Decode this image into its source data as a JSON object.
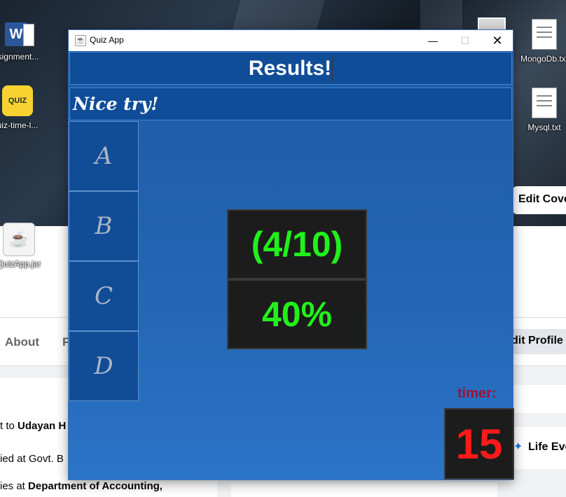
{
  "background": {
    "desktop_icons": [
      {
        "label": "ssignment...",
        "icon": "word-doc-icon"
      },
      {
        "label": "uiz-time-l...",
        "icon": "quiz-image-icon"
      },
      {
        "label": "QuizApp.jar",
        "icon": "java-jar-icon"
      },
      {
        "label": "MongoDb.txt",
        "icon": "text-file-icon"
      },
      {
        "label": "Mysql.txt",
        "icon": "text-file-icon"
      }
    ],
    "edit_cover_label": "Edit Cove",
    "edit_profile_label": "dit Profile",
    "nav": {
      "about": "About",
      "f": "F"
    },
    "intro_lines": [
      {
        "prefix": "t to ",
        "bold": "Udayan H"
      },
      {
        "prefix": "ied at Govt. B",
        "bold": ""
      },
      {
        "prefix": "ies at ",
        "bold": "Department of Accounting,"
      }
    ],
    "life_events": "Life Eve"
  },
  "window": {
    "title": "Quiz App",
    "controls": {
      "minimize": "—",
      "maximize": "☐",
      "close": "✕"
    }
  },
  "quiz": {
    "header": "Results!",
    "message": "Nice try!",
    "options": [
      "A",
      "B",
      "C",
      "D"
    ],
    "score_fraction": "(4/10)",
    "score_percent": "40%",
    "score_value": 0.4,
    "timer_label": "timer:",
    "timer_value": "15"
  },
  "colors": {
    "header_bg": "#0f4d98",
    "panel_bg": "#2467b5",
    "score_text": "#22f01c",
    "timer_text": "#ff1a1a",
    "timer_label": "#9b1338"
  }
}
